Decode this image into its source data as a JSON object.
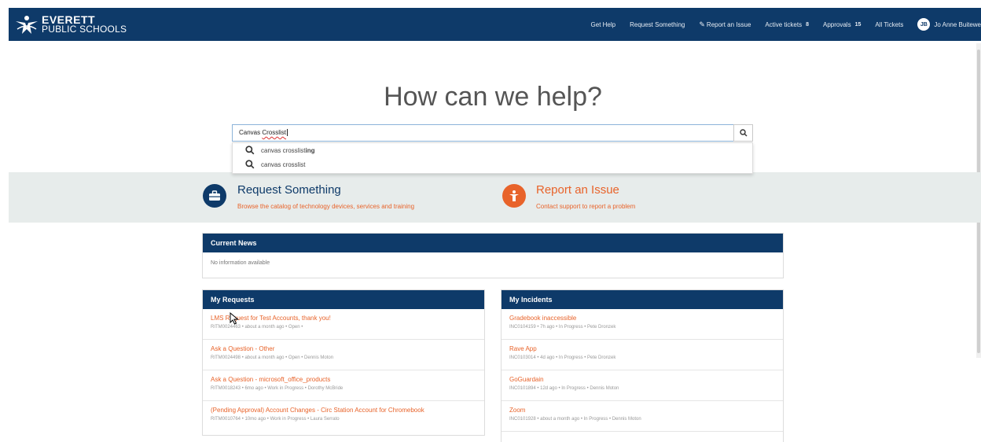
{
  "brand": {
    "line1": "EVERETT",
    "line2": "PUBLIC SCHOOLS"
  },
  "nav": {
    "get_help": "Get Help",
    "request_something": "Request Something",
    "report_issue": "Report an Issue",
    "active_tickets": "Active tickets",
    "active_tickets_count": "8",
    "approvals": "Approvals",
    "approvals_count": "15",
    "all_tickets": "All Tickets",
    "user_initials": "JB",
    "user_name": "Jo Anne Buitewe"
  },
  "hero": {
    "title": "How can we help?"
  },
  "search": {
    "value_prefix": "Canvas ",
    "value_typed": "Crosslist",
    "suggestions": [
      {
        "normal": "canvas crosslist",
        "bold": "ing"
      },
      {
        "normal": "canvas crosslist",
        "bold": ""
      }
    ]
  },
  "services": {
    "request": {
      "title": "Request Something",
      "desc": "Browse the catalog of technology devices, services and training"
    },
    "report": {
      "title": "Report an Issue",
      "desc": "Contact support to report a problem"
    }
  },
  "news": {
    "title": "Current News",
    "empty": "No information available"
  },
  "my_requests": {
    "title": "My Requests",
    "items": [
      {
        "title": "LMS Request for Test Accounts, thank you!",
        "meta": "RITM0024463 • about a month ago • Open •"
      },
      {
        "title": "Ask a Question - Other",
        "meta": "RITM0024498 • about a month ago • Open • Dennis Moton"
      },
      {
        "title": "Ask a Question - microsoft_office_products",
        "meta": "RITM0018243 • 6mo ago • Work in Progress • Dorothy McBride"
      },
      {
        "title": "(Pending Approval) Account Changes - Circ Station Account for Chromebook",
        "meta": "RITM0010764 • 10mo ago • Work in Progress • Laura Serrato"
      }
    ]
  },
  "my_incidents": {
    "title": "My Incidents",
    "items": [
      {
        "title": "Gradebook inaccessible",
        "meta": "INC0104159 • 7h ago • In Progress • Pete Dronzek"
      },
      {
        "title": "Rave App",
        "meta": "INC0103014 • 4d ago • In Progress • Pete Dronzek"
      },
      {
        "title": "GoGuardain",
        "meta": "INC0101894 • 12d ago • In Progress • Dennis Moton"
      },
      {
        "title": "Zoom",
        "meta": "INC0101928 • about a month ago • In Progress • Dennis Moton"
      }
    ]
  },
  "colors": {
    "header": "#0e3a69",
    "accent": "#e8632a",
    "band": "#e7eceb"
  },
  "icons": {
    "search": "search-icon",
    "briefcase": "briefcase-icon",
    "report": "exclamation-person-icon",
    "pencil": "pencil-icon"
  }
}
